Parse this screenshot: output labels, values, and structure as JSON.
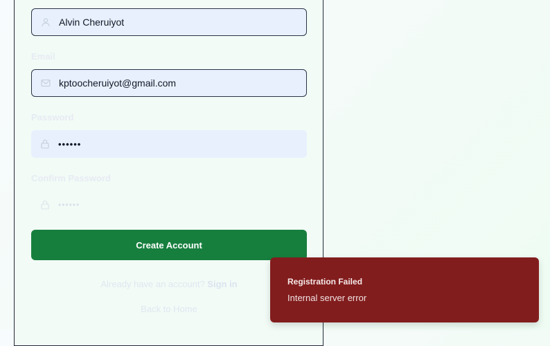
{
  "form": {
    "name_value": "Alvin Cheruiyot",
    "email_label": "Email",
    "email_value": "kptoocheruiyot@gmail.com",
    "password_label": "Password",
    "password_value": "••••••",
    "confirm_label": "Confirm Password",
    "confirm_placeholder": "••••••",
    "create_button_label": "Create Account",
    "signin_prompt": "Already have an account?",
    "signin_link": "Sign in",
    "back_link": "Back to Home"
  },
  "toast": {
    "title": "Registration Failed",
    "message": "Internal server error"
  },
  "icons": {
    "name_field": "user-icon",
    "email_field": "mail-icon",
    "password_field": "lock-icon",
    "confirm_field": "lock-icon"
  },
  "colors": {
    "primary_button": "#177f3e",
    "toast_background": "#821d1d",
    "input_fill": "#e8f0fe",
    "panel_border": "#1f2a37"
  }
}
